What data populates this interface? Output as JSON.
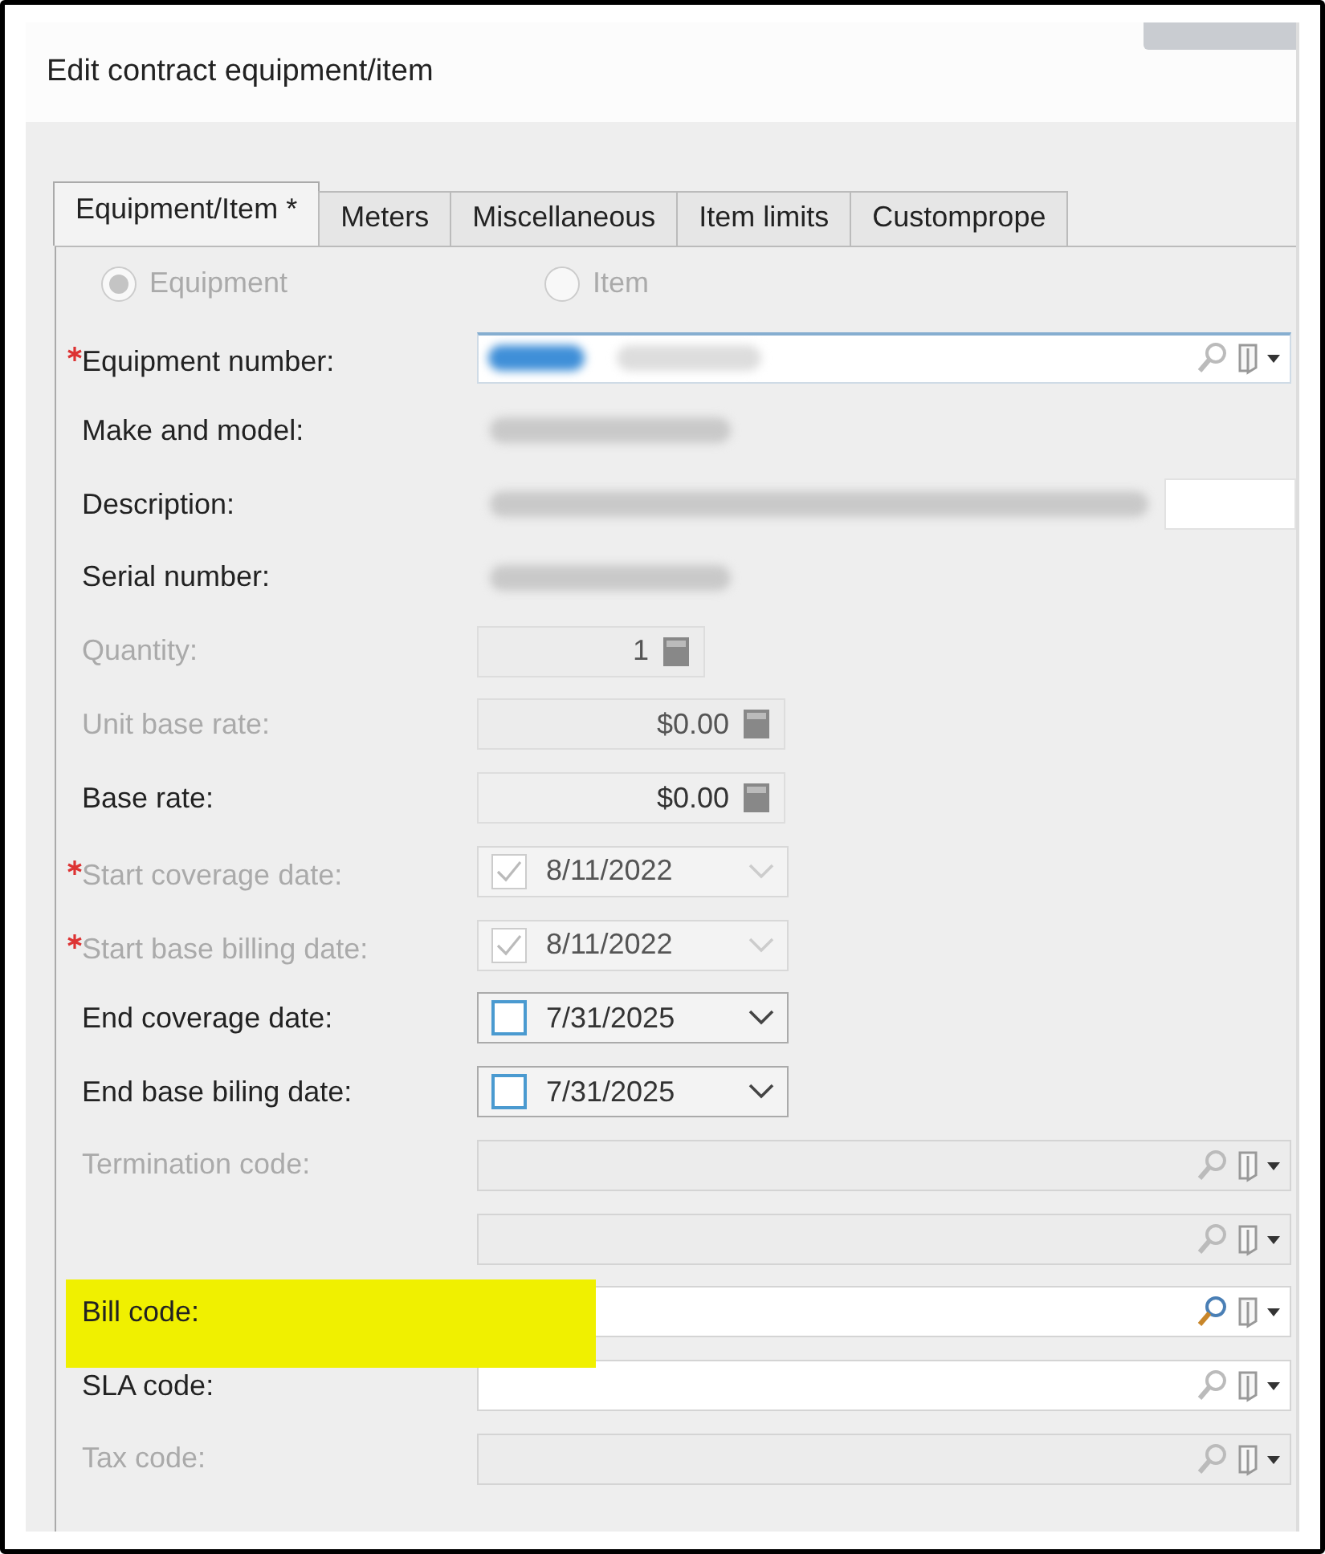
{
  "window": {
    "title": "Edit contract equipment/item"
  },
  "tabs": [
    {
      "label": "Equipment/Item *",
      "selected": true
    },
    {
      "label": "Meters",
      "selected": false
    },
    {
      "label": "Miscellaneous",
      "selected": false
    },
    {
      "label": "Item limits",
      "selected": false
    },
    {
      "label": "Customprope",
      "selected": false
    }
  ],
  "type_choice": {
    "disabled": true,
    "options": [
      {
        "label": "Equipment",
        "selected": true
      },
      {
        "label": "Item",
        "selected": false
      }
    ]
  },
  "fields": [
    {
      "kind": "lookup",
      "label": "Equipment number:",
      "required": true,
      "disabled": false,
      "redacted": true
    },
    {
      "kind": "text",
      "label": "Make and model:",
      "required": false,
      "disabled": false,
      "redacted": true
    },
    {
      "kind": "text",
      "label": "Description:",
      "required": false,
      "disabled": false,
      "redacted": true,
      "extra_box": true
    },
    {
      "kind": "text",
      "label": "Serial number:",
      "required": false,
      "disabled": false,
      "redacted": true
    },
    {
      "kind": "number",
      "label": "Quantity:",
      "required": false,
      "disabled": true,
      "value": "1"
    },
    {
      "kind": "number",
      "label": "Unit base rate:",
      "required": false,
      "disabled": true,
      "value": "$0.00"
    },
    {
      "kind": "number",
      "label": "Base rate:",
      "required": false,
      "disabled": false,
      "value": "$0.00"
    },
    {
      "kind": "date",
      "label": "Start coverage date:",
      "required": true,
      "disabled": true,
      "checked": true,
      "value": "8/11/2022"
    },
    {
      "kind": "date",
      "label": "Start base billing date:",
      "required": true,
      "disabled": true,
      "checked": true,
      "value": "8/11/2022"
    },
    {
      "kind": "date",
      "label": "End coverage date:",
      "required": false,
      "disabled": false,
      "checked": false,
      "value": "7/31/2025"
    },
    {
      "kind": "date",
      "label": "End base biling date:",
      "required": false,
      "disabled": false,
      "checked": false,
      "value": "7/31/2025"
    },
    {
      "kind": "lookup",
      "label": "Termination code:",
      "required": false,
      "disabled": true
    },
    {
      "kind": "lookup",
      "disabled": true
    },
    {
      "kind": "lookup",
      "label": "Bill code:",
      "required": false,
      "disabled": false,
      "highlighted": true
    },
    {
      "kind": "lookup",
      "label": "SLA code:",
      "required": false,
      "disabled": false
    },
    {
      "kind": "lookup",
      "label": "Tax code:",
      "required": false,
      "disabled": true
    }
  ]
}
